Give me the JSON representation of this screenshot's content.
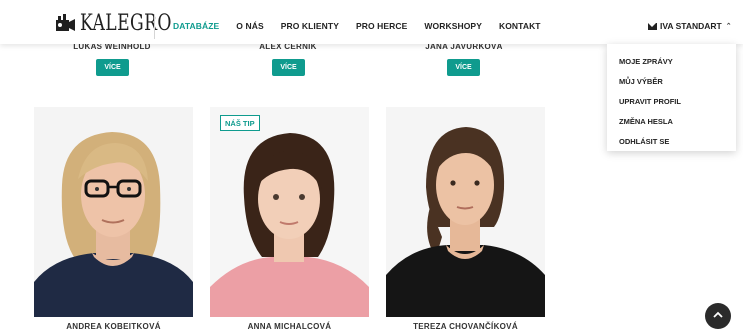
{
  "header": {
    "logo_text": "KALEGRO",
    "nav": [
      {
        "label": "DATABÁZE",
        "active": true
      },
      {
        "label": "O NÁS",
        "active": false
      },
      {
        "label": "PRO KLIENTY",
        "active": false
      },
      {
        "label": "PRO HERCE",
        "active": false
      },
      {
        "label": "WORKSHOPY",
        "active": false
      },
      {
        "label": "KONTAKT",
        "active": false
      }
    ],
    "user_label": "IVA STANDART",
    "user_icon": "envelope-icon",
    "user_chevron": "chevron-up-icon"
  },
  "user_dropdown": {
    "items": [
      "MOJE ZPRÁVY",
      "MŮJ VÝBĚR",
      "UPRAVIT PROFIL",
      "ZMĚNA HESLA",
      "ODHLÁSIT SE"
    ]
  },
  "top_row": [
    {
      "name": "LUKÁŠ WEINHOLD",
      "button": "VÍCE"
    },
    {
      "name": "ALEX ČERNÍK",
      "button": "VÍCE"
    },
    {
      "name": "JANA JAVŮRKOVÁ",
      "button": "VÍCE"
    }
  ],
  "cards": [
    {
      "name": "ANDREA KOBEITKOVÁ",
      "badge": ""
    },
    {
      "name": "ANNA MICHALCOVÁ",
      "badge": "NÁŠ TIP"
    },
    {
      "name": "TEREZA CHOVANČÍKOVÁ",
      "badge": ""
    }
  ],
  "colors": {
    "accent": "#0f9b8e",
    "text": "#222222",
    "scroll_button": "#2b2b2b"
  },
  "scroll_top_icon": "chevron-up-icon"
}
